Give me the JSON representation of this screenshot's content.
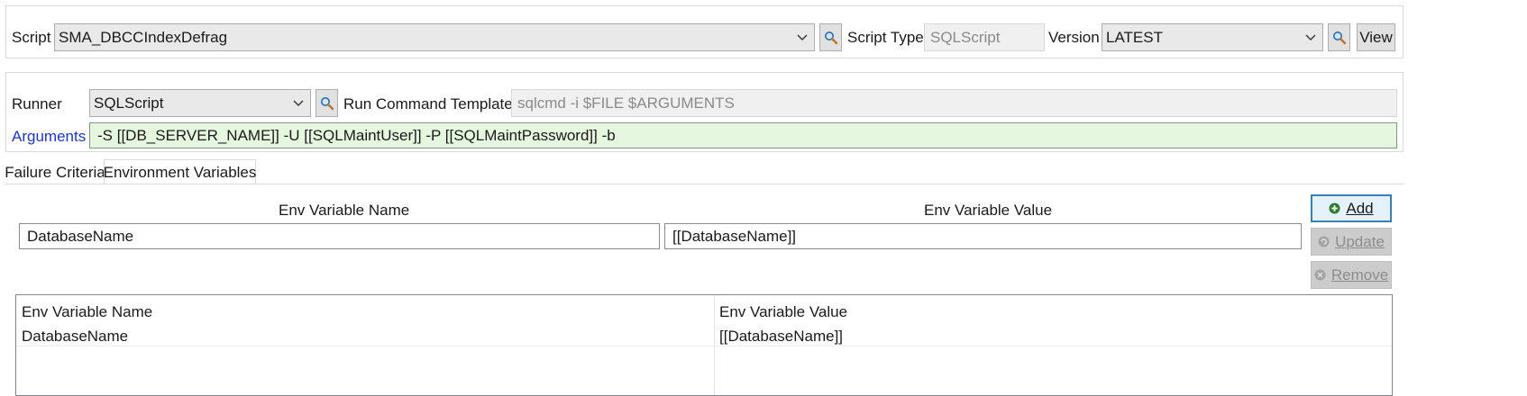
{
  "script_group": {
    "script_label": "Script",
    "script_value": "SMA_DBCCIndexDefrag",
    "script_type_label": "Script Type",
    "script_type_value": "SQLScript",
    "version_label": "Version",
    "version_value": "LATEST",
    "view_label": "View"
  },
  "runner_group": {
    "runner_label": "Runner",
    "runner_value": "SQLScript",
    "template_label": "Run Command Template",
    "template_value": "sqlcmd -i $FILE $ARGUMENTS",
    "arguments_label": "Arguments",
    "arguments_value": "-S [[DB_SERVER_NAME]] -U [[SQLMaintUser]] -P [[SQLMaintPassword]] -b"
  },
  "tabs": [
    {
      "label": "Failure Criteria",
      "active": false
    },
    {
      "label": "Environment Variables",
      "active": true
    }
  ],
  "env_editor": {
    "name_header": "Env Variable Name",
    "value_header": "Env Variable Value",
    "name_value": "DatabaseName",
    "value_value": "[[DatabaseName]]",
    "add_label": "Add",
    "update_label": "Update",
    "remove_label": "Remove"
  },
  "env_table": {
    "columns": [
      "Env Variable Name",
      "Env Variable Value"
    ],
    "rows": [
      [
        "DatabaseName",
        "[[DatabaseName]]"
      ]
    ]
  },
  "colors": {
    "arguments_link": "#1f35c8",
    "arguments_bg": "#e6f7e0",
    "add_border": "#3c7fb1"
  }
}
